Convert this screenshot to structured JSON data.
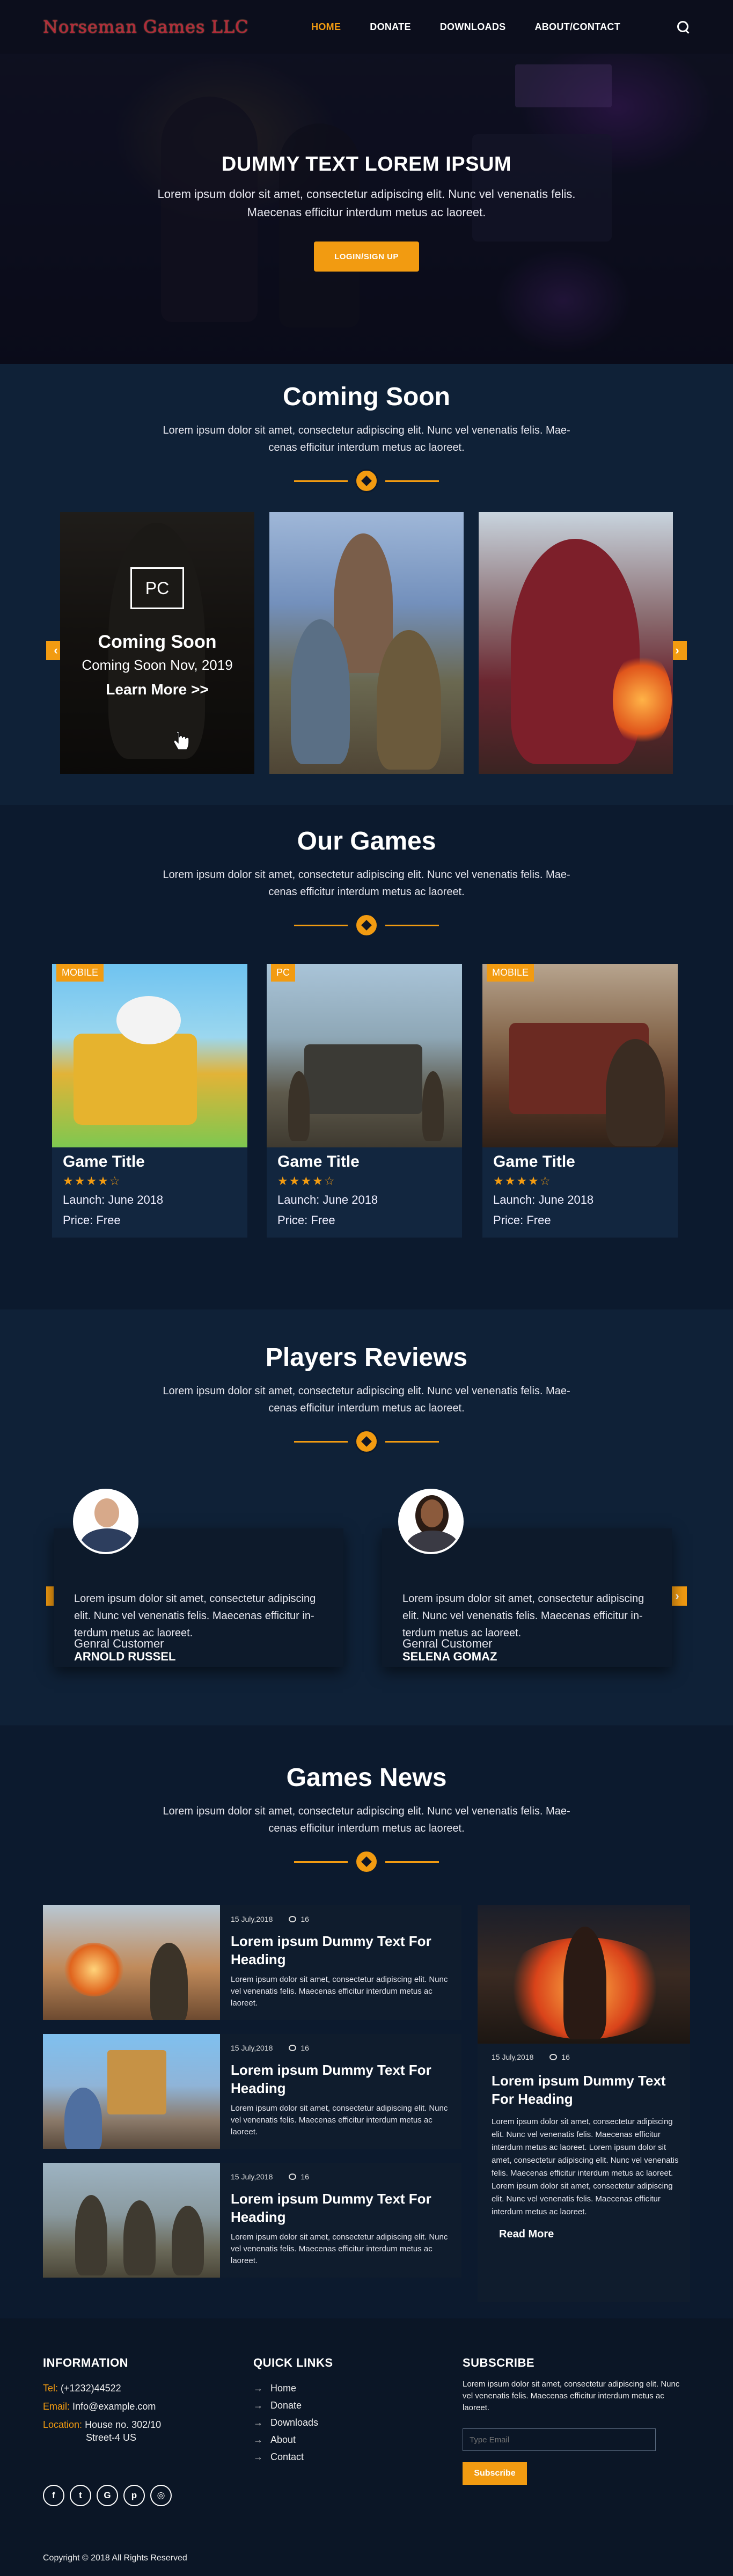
{
  "nav": {
    "logo": "Norseman Games LLC",
    "items": [
      "HOME",
      "DONATE",
      "DOWNLOADS",
      "ABOUT/CONTACT"
    ]
  },
  "hero": {
    "title": "DUMMY TEXT LOREM IPSUM",
    "line1": "Lorem ipsum dolor sit amet, consectetur adipiscing elit. Nunc vel venenatis felis.",
    "line2": "Maecenas efficitur interdum metus ac laoreet.",
    "button": "LOGIN/SIGN UP"
  },
  "coming": {
    "title": "Coming Soon",
    "sub1": "Lorem ipsum dolor sit amet, consectetur adipiscing elit. Nunc vel venenatis felis. Mae-",
    "sub2": "cenas efficitur interdum metus ac laoreet.",
    "card": {
      "platform": "PC",
      "title": "Coming Soon",
      "date": "Coming Soon Nov, 2019",
      "more": "Learn More >>"
    }
  },
  "games": {
    "title": "Our Games",
    "sub1": "Lorem ipsum dolor sit amet, consectetur adipiscing elit. Nunc vel venenatis felis. Mae-",
    "sub2": "cenas efficitur interdum metus ac laoreet.",
    "cards": [
      {
        "tag": "MOBILE",
        "title": "Game Title",
        "rating": 4,
        "stars": "★★★★☆",
        "launch": "Launch: June 2018",
        "price": "Price: Free"
      },
      {
        "tag": "PC",
        "title": "Game Title",
        "rating": 4,
        "stars": "★★★★☆",
        "launch": "Launch: June 2018",
        "price": "Price: Free"
      },
      {
        "tag": "MOBILE",
        "title": "Game Title",
        "rating": 4,
        "stars": "★★★★☆",
        "launch": "Launch: June 2018",
        "price": "Price: Free"
      }
    ]
  },
  "reviews": {
    "title": "Players Reviews",
    "sub1": "Lorem ipsum dolor sit amet, consectetur adipiscing elit. Nunc vel venenatis felis. Mae-",
    "sub2": "cenas efficitur interdum metus ac laoreet.",
    "items": [
      {
        "text1": "Lorem ipsum dolor sit amet, consectetur adipiscing",
        "text2": "elit. Nunc vel venenatis felis. Maecenas efficitur in-",
        "text3": "terdum metus ac laoreet.",
        "name": "ARNOLD RUSSEL",
        "role": "Genral Customer"
      },
      {
        "text1": "Lorem ipsum dolor sit amet, consectetur adipiscing",
        "text2": "elit. Nunc vel venenatis felis. Maecenas efficitur in-",
        "text3": "terdum metus ac laoreet.",
        "name": "SELENA GOMAZ",
        "role": "Genral Customer"
      }
    ]
  },
  "news": {
    "title": "Games News",
    "sub1": "Lorem ipsum dolor sit amet, consectetur adipiscing elit. Nunc vel venenatis felis. Mae-",
    "sub2": "cenas efficitur interdum metus ac laoreet.",
    "items": [
      {
        "date": "15 July,2018",
        "comments": "16",
        "heading": "Lorem ipsum Dummy Text For Heading",
        "body": "Lorem ipsum dolor sit amet, consectetur adipiscing elit. Nunc vel venenatis felis. Maecenas efficitur interdum metus ac laoreet."
      },
      {
        "date": "15 July,2018",
        "comments": "16",
        "heading": "Lorem ipsum Dummy Text For Heading",
        "body": "Lorem ipsum dolor sit amet, consectetur adipiscing elit. Nunc vel venenatis felis. Maecenas efficitur interdum metus ac laoreet."
      },
      {
        "date": "15 July,2018",
        "comments": "16",
        "heading": "Lorem ipsum Dummy Text For Heading",
        "body": "Lorem ipsum dolor sit amet, consectetur adipiscing elit. Nunc vel venenatis felis. Maecenas efficitur interdum metus ac laoreet."
      }
    ],
    "featured": {
      "date": "15 July,2018",
      "comments": "16",
      "heading": "Lorem ipsum Dummy Text For Heading",
      "body": "Lorem ipsum dolor sit amet, consectetur adipiscing elit. Nunc vel venenatis felis. Maecenas efficitur interdum metus ac laoreet. Lorem ipsum dolor sit amet, consectetur adipiscing elit. Nunc vel venenatis felis. Maecenas efficitur interdum metus ac laoreet. Lorem ipsum dolor sit amet, consectetur adipiscing elit. Nunc vel venenatis felis. Maecenas efficitur interdum metus ac laoreet.",
      "read_more": "Read More"
    }
  },
  "footer": {
    "info_title": "INFORMATION",
    "tel_label": "Tel:",
    "tel": "(+1232)44522",
    "email_label": "Email:",
    "email": "Info@example.com",
    "loc_label": "Location:",
    "loc1": "House no. 302/10",
    "loc2": "Street-4 US",
    "links_title": "QUICK LINKS",
    "links": [
      "Home",
      "Donate",
      "Downloads",
      "About",
      "Contact"
    ],
    "sub_title": "SUBSCRIBE",
    "sub_text": "Lorem ipsum dolor sit amet, consectetur adipiscing elit. Nunc vel venenatis felis. Maecenas efficitur interdum metus ac laoreet.",
    "email_placeholder": "Type Email",
    "sub_button": "Subscribe",
    "social": [
      "f",
      "t",
      "G",
      "p",
      "◎"
    ],
    "copyright": "Copyright © 2018 All Rights Reserved"
  },
  "colors": {
    "accent": "#f29b11",
    "bg_dark": "#0c1a2e",
    "bg_alt": "#0f2137"
  }
}
